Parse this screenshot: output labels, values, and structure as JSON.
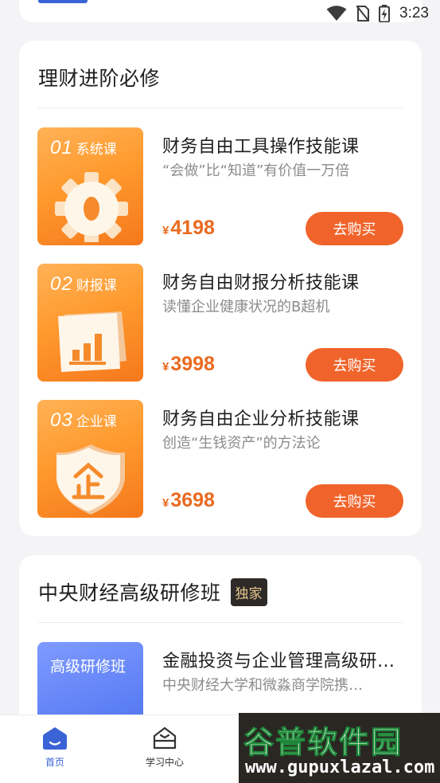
{
  "status_bar": {
    "time": "3:23"
  },
  "sections": [
    {
      "title": "理财进阶必修",
      "courses": [
        {
          "num": "01",
          "type": "系统课",
          "name": "财务自由工具操作技能课",
          "desc": "“会做”比“知道”有价值一万倍",
          "price_symbol": "¥",
          "price": "4198",
          "button": "去购买",
          "art": "gear-icon"
        },
        {
          "num": "02",
          "type": "财报课",
          "name": "财务自由财报分析技能课",
          "desc": "读懂企业健康状况的B超机",
          "price_symbol": "¥",
          "price": "3998",
          "button": "去购买",
          "art": "bar-chart-icon"
        },
        {
          "num": "03",
          "type": "企业课",
          "name": "财务自由企业分析技能课",
          "desc": "创造“生钱资产”的方法论",
          "price_symbol": "¥",
          "price": "3698",
          "button": "去购买",
          "art": "shield-icon"
        }
      ]
    },
    {
      "title": "中央财经高级研修班",
      "badge": "独家",
      "courses": [
        {
          "type": "高级研修班",
          "name": "金融投资与企业管理高级研…",
          "desc": "中央财经大学和微淼商学院携…"
        }
      ]
    }
  ],
  "tabbar": {
    "items": [
      {
        "label": "首页",
        "icon": "home-icon",
        "active": true
      },
      {
        "label": "学习中心",
        "icon": "study-center-icon",
        "active": false
      }
    ]
  },
  "watermark": {
    "title": "谷普软件园",
    "url": "www.gupuxlazal.com"
  },
  "colors": {
    "accent": "#f0642b",
    "price": "#e96a1f",
    "brand_blue": "#3a63d6",
    "badge_bg": "#2d2a28",
    "badge_text": "#e8c98f"
  }
}
